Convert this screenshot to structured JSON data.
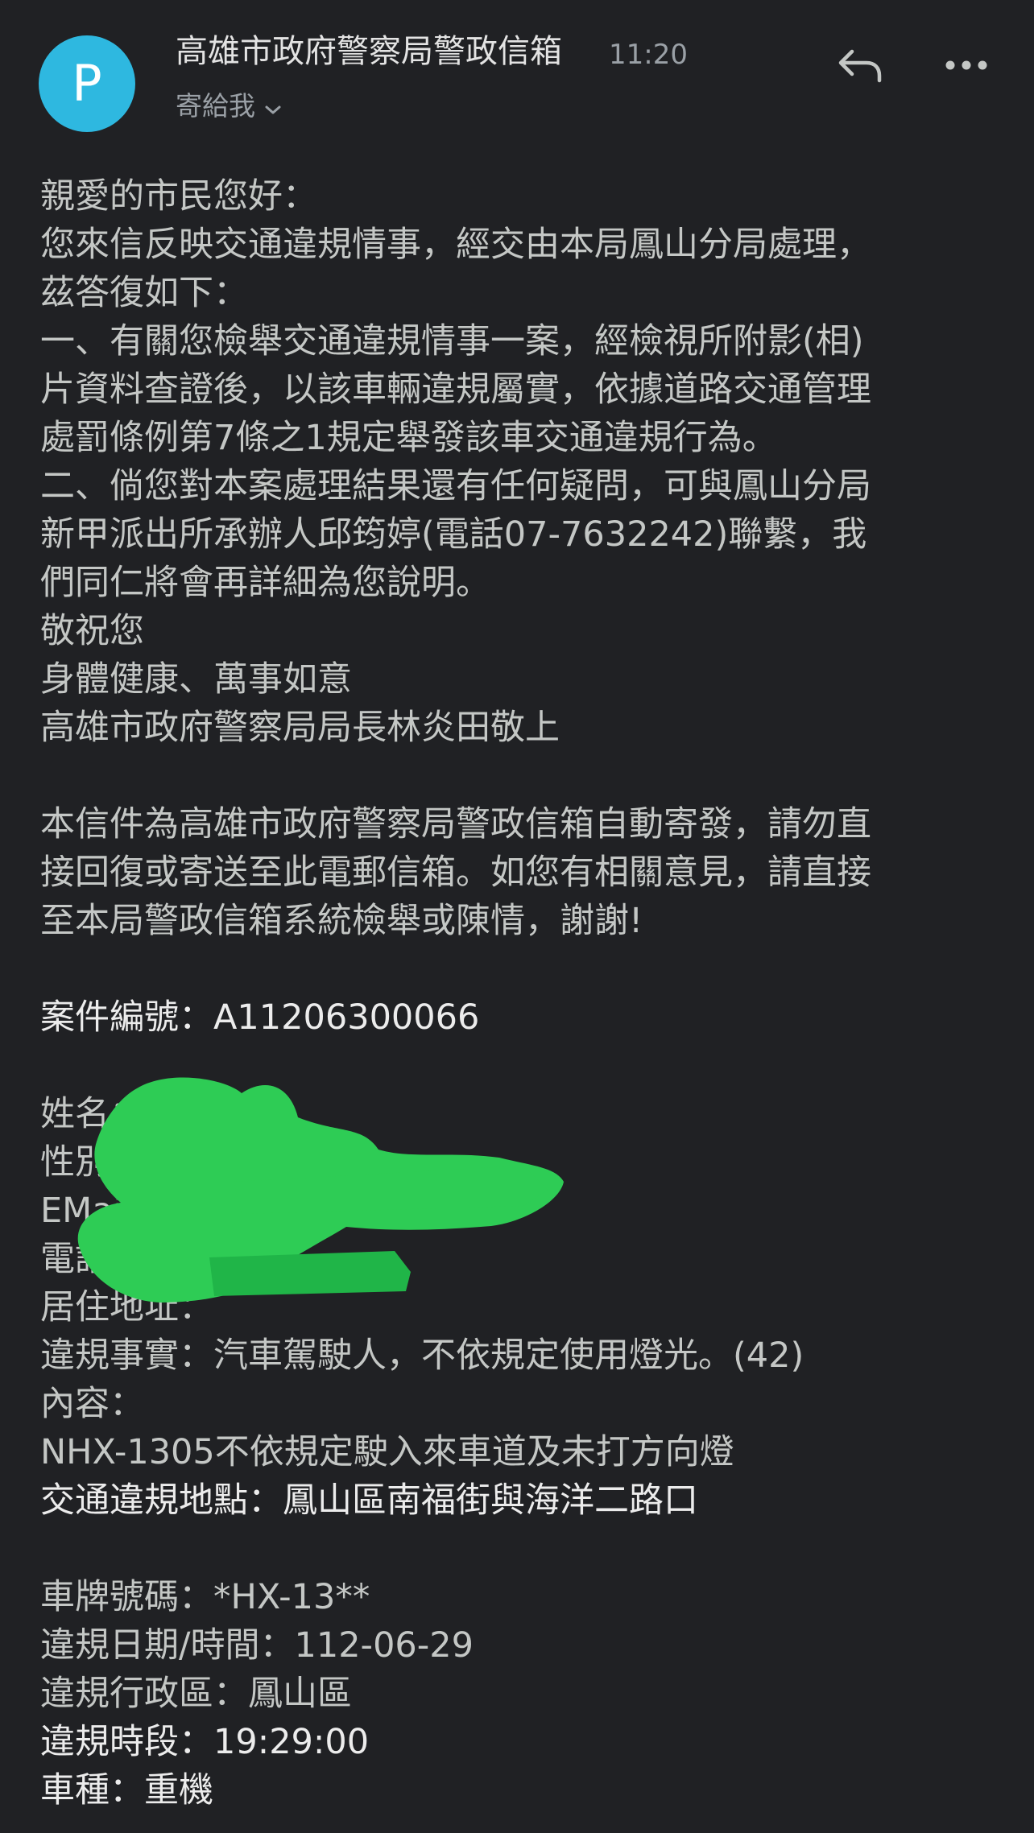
{
  "header": {
    "avatar_letter": "P",
    "sender": "高雄市政府警察局警政信箱",
    "time": "11:20",
    "recipient": "寄給我",
    "avatar_color": "#2eb8e0"
  },
  "icons": {
    "reply": "reply-icon",
    "more": "more-options-icon",
    "chevron": "chevron-down-icon"
  },
  "body": {
    "greeting": "親愛的市民您好：",
    "p1_line1": "您來信反映交通違規情事，經交由本局鳳山分局處理，",
    "p1_line2": "茲答復如下：",
    "p2_line1": "一、有關您檢舉交通違規情事一案，經檢視所附影(相)",
    "p2_line2": "片資料查證後，以該車輛違規屬實，依據道路交通管理",
    "p2_line3": "處罰條例第7條之1規定舉發該車交通違規行為。",
    "p3_line1": "二、倘您對本案處理結果還有任何疑問，可與鳳山分局",
    "p3_line2": "新甲派出所承辦人邱筠婷(電話07-7632242)聯繫，我",
    "p3_line3": "們同仁將會再詳細為您說明。",
    "closing1": "敬祝您",
    "closing2": "身體健康、萬事如意",
    "signature": "高雄市政府警察局局長林炎田敬上",
    "notice_line1": "本信件為高雄市政府警察局警政信箱自動寄發，請勿直",
    "notice_line2": "接回復或寄送至此電郵信箱。如您有相關意見，請直接",
    "notice_line3": "至本局警政信箱系統檢舉或陳情，謝謝!",
    "case_number": "案件編號：A11206300066",
    "name_label": "姓名：",
    "gender_label": "性別：",
    "email_label": "EMail：",
    "phone_label": "電話：",
    "address_label": "居住地址：",
    "violation_fact": "違規事實：汽車駕駛人，不依規定使用燈光。(42)",
    "content_label": "內容：",
    "content_text": "NHX-1305不依規定駛入來車道及未打方向燈",
    "location": "交通違規地點：鳳山區南福街與海洋二路口",
    "plate": "車牌號碼：*HX-13**",
    "date": "違規日期/時間：112-06-29",
    "district": "違規行政區：鳳山區",
    "time_slot": "違規時段：19:29:00",
    "vehicle_type": "車種：重機"
  },
  "redaction_color": "#2ecc55"
}
